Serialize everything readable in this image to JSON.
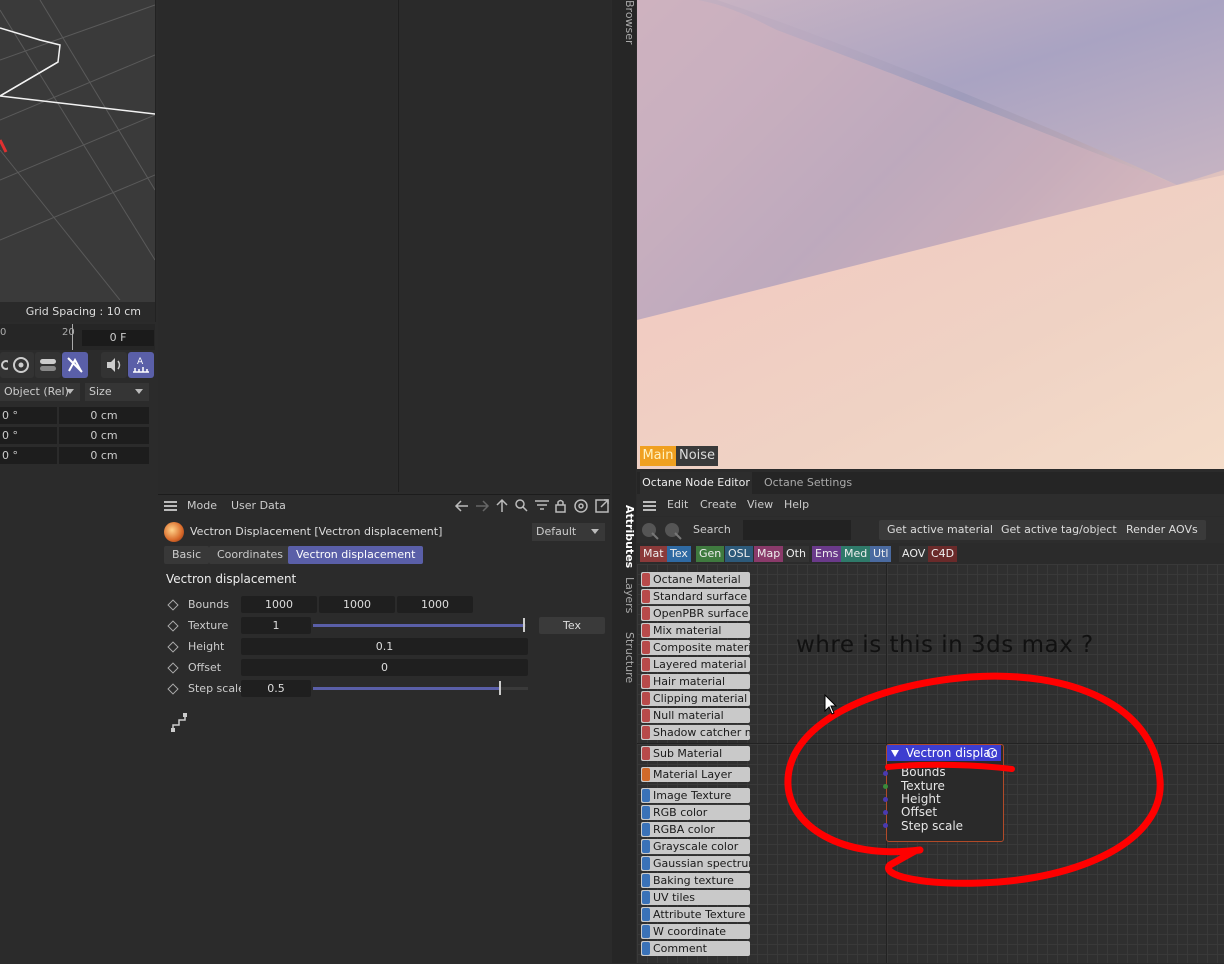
{
  "viewport": {
    "grid_spacing": "Grid Spacing : 10 cm"
  },
  "timeline": {
    "tick_a": "0",
    "tick_b": "20",
    "frame": "0 F"
  },
  "coords": {
    "mode_drop": "Object (Rel)",
    "size_drop": "Size",
    "rows": [
      {
        "rot": "0 °",
        "size": "0 cm"
      },
      {
        "rot": "0 °",
        "size": "0 cm"
      },
      {
        "rot": "0 °",
        "size": "0 cm"
      }
    ]
  },
  "attributes": {
    "menu": [
      "Mode",
      "User Data"
    ],
    "object_title": "Vectron Displacement [Vectron displacement]",
    "preset": "Default",
    "tabs": [
      "Basic",
      "Coordinates",
      "Vectron displacement"
    ],
    "section_title": "Vectron displacement",
    "bounds": {
      "label": "Bounds",
      "values": [
        "1000",
        "1000",
        "1000"
      ]
    },
    "texture": {
      "label": "Texture",
      "value": "1",
      "level": 1.0,
      "button": "Tex"
    },
    "height": {
      "label": "Height",
      "value": "0.1"
    },
    "offset": {
      "label": "Offset",
      "value": "0"
    },
    "step_scale": {
      "label": "Step scale",
      "value": "0.5",
      "level": 0.88
    }
  },
  "side_tabs": [
    "Browser",
    "Attributes",
    "Layers",
    "Structure"
  ],
  "render_view": {
    "tabs": [
      "Main",
      "Noise"
    ],
    "active_color": "#f0a020"
  },
  "node_editor": {
    "tabs": [
      "Octane Node Editor",
      "Octane Settings"
    ],
    "menu": [
      "Edit",
      "Create",
      "View",
      "Help"
    ],
    "search_label": "Search",
    "buttons": [
      "Get active material",
      "Get active tag/object",
      "Render AOVs"
    ],
    "categories": [
      {
        "label": "Mat",
        "color": "#8b3a3a"
      },
      {
        "label": "Tex",
        "color": "#2f6aa3"
      },
      {
        "label": "Gen",
        "color": "#3f7a3f"
      },
      {
        "label": "OSL",
        "color": "#2d5a7a"
      },
      {
        "label": "Map",
        "color": "#8a3a6a"
      },
      {
        "label": "Oth",
        "color": "#333333"
      },
      {
        "label": "Ems",
        "color": "#6a3a8a"
      },
      {
        "label": "Med",
        "color": "#2f7a6a"
      },
      {
        "label": "Utl",
        "color": "#4a6aa0"
      },
      {
        "label": "AOV",
        "color": "#333333"
      },
      {
        "label": "C4D",
        "color": "#6a2a2a"
      }
    ],
    "node_list": [
      {
        "label": "Octane Material",
        "color": "#b84a4a"
      },
      {
        "label": "Standard surface m",
        "color": "#b84a4a"
      },
      {
        "label": "OpenPBR surface m",
        "color": "#b84a4a"
      },
      {
        "label": "Mix material",
        "color": "#b84a4a"
      },
      {
        "label": "Composite materia",
        "color": "#b84a4a"
      },
      {
        "label": "Layered material",
        "color": "#b84a4a"
      },
      {
        "label": "Hair material",
        "color": "#b84a4a"
      },
      {
        "label": "Clipping material",
        "color": "#b84a4a"
      },
      {
        "label": "Null material",
        "color": "#b84a4a"
      },
      {
        "label": "Shadow catcher m",
        "color": "#b84a4a"
      },
      {
        "label": "Sub Material",
        "color": "#b84a4a"
      },
      {
        "label": "Material Layer",
        "color": "#d06a2a"
      },
      {
        "label": "Image Texture",
        "color": "#3a72b8"
      },
      {
        "label": "RGB color",
        "color": "#3a72b8"
      },
      {
        "label": "RGBA color",
        "color": "#3a72b8"
      },
      {
        "label": "Grayscale color",
        "color": "#3a72b8"
      },
      {
        "label": "Gaussian spectrum",
        "color": "#3a72b8"
      },
      {
        "label": "Baking texture",
        "color": "#3a72b8"
      },
      {
        "label": "UV tiles",
        "color": "#3a72b8"
      },
      {
        "label": "Attribute Texture",
        "color": "#3a72b8"
      },
      {
        "label": "W coordinate",
        "color": "#3a72b8"
      },
      {
        "label": "Comment",
        "color": "#3a72b8"
      }
    ],
    "vectron_node": {
      "title": "Vectron displac",
      "ports": [
        "Bounds",
        "Texture",
        "Height",
        "Offset",
        "Step scale"
      ]
    },
    "annotation": "whre is this in 3ds max ?",
    "annotation_color": "#ff0000"
  }
}
